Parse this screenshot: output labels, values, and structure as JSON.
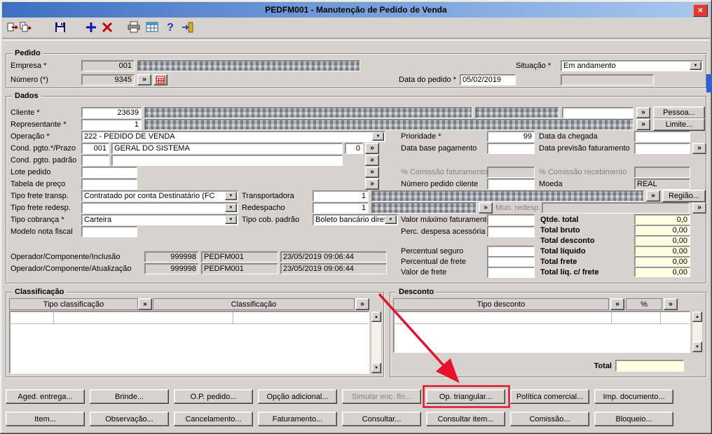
{
  "window": {
    "title": "PEDFM001 - Manutenção de Pedido de Venda"
  },
  "glyphs": {
    "expand": "»",
    "dropdown": "▼",
    "up": "▲",
    "down": "▼",
    "close": "✕"
  },
  "toolbar": {
    "icons": [
      "nav-transfer-icon",
      "nav-copy-icon",
      "save-icon",
      "add-icon",
      "delete-icon",
      "print-icon",
      "table-icon",
      "help-icon",
      "exit-icon"
    ]
  },
  "pedido": {
    "legend": "Pedido",
    "empresa": {
      "label": "Empresa *",
      "value": "001"
    },
    "numero": {
      "label": "Número (*)",
      "value": "9345"
    },
    "data_pedido": {
      "label": "Data do pedido *",
      "value": "05/02/2019"
    },
    "situacao": {
      "label": "Situação *",
      "value": "Em andamento"
    }
  },
  "dados": {
    "legend": "Dados",
    "cliente": {
      "label": "Cliente *",
      "value": "23639"
    },
    "representante": {
      "label": "Representante *",
      "value": "1"
    },
    "pessoa_button": "Pessoa...",
    "limite_button": "Limite...",
    "operacao": {
      "label": "Operação *",
      "value": "222 - PEDIDO DE VENDA"
    },
    "prioridade": {
      "label": "Prioridade *",
      "value": "99"
    },
    "data_chegada": {
      "label": "Data da chegada"
    },
    "cond_pgto": {
      "label": "Cond. pgto.*/Prazo",
      "code": "001",
      "desc": "GERAL DO SISTEMA",
      "prazo": "0"
    },
    "cond_pgto_padrao": {
      "label": "Cond. pgto. padrão"
    },
    "data_base": {
      "label": "Data base pagamento"
    },
    "data_previsao": {
      "label": "Data previsão faturamento"
    },
    "comissao_fat": {
      "label": "% Comissão faturamento"
    },
    "comissao_rec": {
      "label": "% Comissão recebimento"
    },
    "lote": {
      "label": "Lote pedido"
    },
    "tabela_preco": {
      "label": "Tabela de preço"
    },
    "numero_pedido_cliente": {
      "label": "Número pedido cliente"
    },
    "moeda": {
      "label": "Moeda",
      "value": "REAL"
    },
    "tipo_frete_transp": {
      "label": "Tipo frete transp.",
      "value": "Contratado por conta Destinatário (FC"
    },
    "transportadora": {
      "label": "Transportadora",
      "value": "1"
    },
    "regiao_button": "Região...",
    "tipo_frete_redesp": {
      "label": "Tipo frete redesp."
    },
    "redespacho": {
      "label": "Redespacho",
      "value": "1"
    },
    "mun_redesp": {
      "label": "Mun. redesp."
    },
    "tipo_cobranca": {
      "label": "Tipo cobrança *",
      "value": "Carteira"
    },
    "tipo_cob_padrao": {
      "label": "Tipo cob. padrão",
      "value": "Boleto bancário direto"
    },
    "valor_maximo": {
      "label": "Valor máximo faturamento"
    },
    "perc_despesa": {
      "label": "Perc. despesa acessória"
    },
    "modelo_nf": {
      "label": "Modelo nota fiscal"
    },
    "percentual_seguro": {
      "label": "Percentual seguro"
    },
    "percentual_frete": {
      "label": "Percentual de frete"
    },
    "valor_frete": {
      "label": "Valor de frete"
    },
    "totais": [
      {
        "label": "Qtde. total",
        "value": "0,0"
      },
      {
        "label": "Total bruto",
        "value": "0,00"
      },
      {
        "label": "Total desconto",
        "value": "0,00"
      },
      {
        "label": "Total líquido",
        "value": "0,00"
      },
      {
        "label": "Total frete",
        "value": "0,00"
      },
      {
        "label": "Total líq. c/ frete",
        "value": "0,00"
      }
    ],
    "operador_inclusao": {
      "label": "Operador/Componente/Inclusão",
      "operador": "999998",
      "componente": "PEDFM001",
      "datahora": "23/05/2019 09:06:44"
    },
    "operador_atualizacao": {
      "label": "Operador/Componente/Atualização",
      "operador": "999998",
      "componente": "PEDFM001",
      "datahora": "23/05/2019 09:06:44"
    }
  },
  "classificacao": {
    "legend": "Classificação",
    "col_tipo": "Tipo classificação",
    "col_class": "Classificação"
  },
  "desconto": {
    "legend": "Desconto",
    "col_tipo": "Tipo desconto",
    "col_pct": "%",
    "total_label": "Total"
  },
  "actions_row1": [
    "Aged. entrega...",
    "Brinde...",
    "O.P. pedido...",
    "Opção adicional...",
    "Simular enc. fin...",
    "Op. triangular...",
    "Política comercial...",
    "Imp. documento..."
  ],
  "actions_row2": [
    "Item...",
    "Observação...",
    "Cancelamento...",
    "Faturamento...",
    "Consultar...",
    "Consultar item...",
    "Comissão...",
    "Bloqueio..."
  ]
}
